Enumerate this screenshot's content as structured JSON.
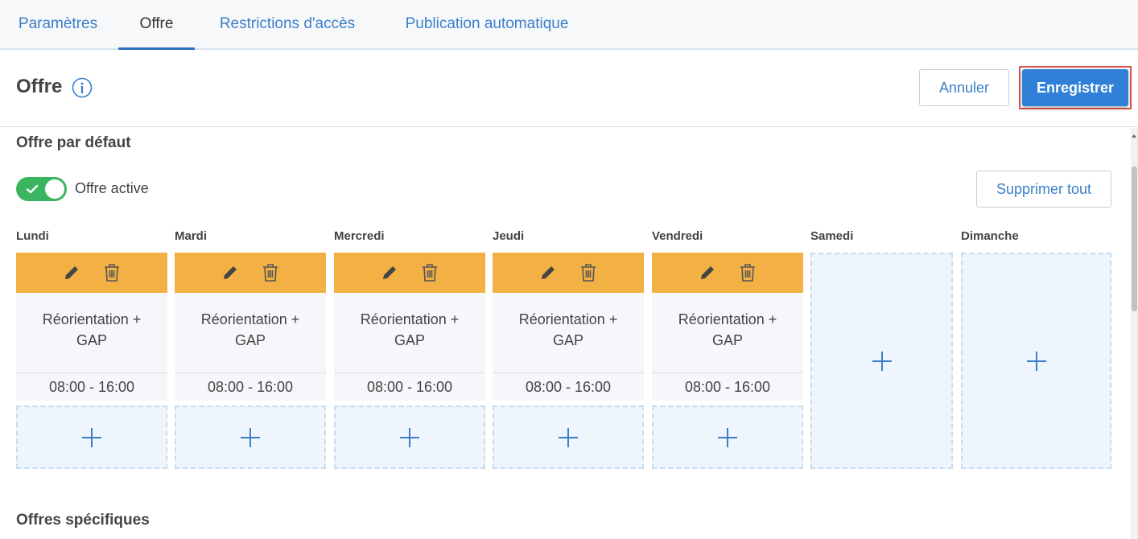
{
  "tabs": [
    {
      "label": "Paramètres",
      "active": false
    },
    {
      "label": "Offre",
      "active": true
    },
    {
      "label": "Restrictions d'accès",
      "active": false
    },
    {
      "label": "Publication automatique",
      "active": false
    }
  ],
  "header": {
    "title": "Offre",
    "info_icon": "info-circle-icon",
    "cancel_label": "Annuler",
    "save_label": "Enregistrer"
  },
  "default_offer": {
    "section_title": "Offre par défaut",
    "toggle_label": "Offre active",
    "toggle_on": true,
    "delete_all_label": "Supprimer tout",
    "days": [
      {
        "label": "Lundi",
        "slot": {
          "name_line1": "Réorientation +",
          "name_line2": "GAP",
          "time": "08:00 - 16:00"
        }
      },
      {
        "label": "Mardi",
        "slot": {
          "name_line1": "Réorientation +",
          "name_line2": "GAP",
          "time": "08:00 - 16:00"
        }
      },
      {
        "label": "Mercredi",
        "slot": {
          "name_line1": "Réorientation +",
          "name_line2": "GAP",
          "time": "08:00 - 16:00"
        }
      },
      {
        "label": "Jeudi",
        "slot": {
          "name_line1": "Réorientation +",
          "name_line2": "GAP",
          "time": "08:00 - 16:00"
        }
      },
      {
        "label": "Vendredi",
        "slot": {
          "name_line1": "Réorientation +",
          "name_line2": "GAP",
          "time": "08:00 - 16:00"
        }
      },
      {
        "label": "Samedi",
        "slot": null
      },
      {
        "label": "Dimanche",
        "slot": null
      }
    ]
  },
  "specific_offers": {
    "section_title": "Offres spécifiques"
  },
  "colors": {
    "accent": "#2f80d6",
    "slot_bar": "#f2b045",
    "toggle_on": "#3bb55f",
    "highlight": "#d9534f"
  }
}
